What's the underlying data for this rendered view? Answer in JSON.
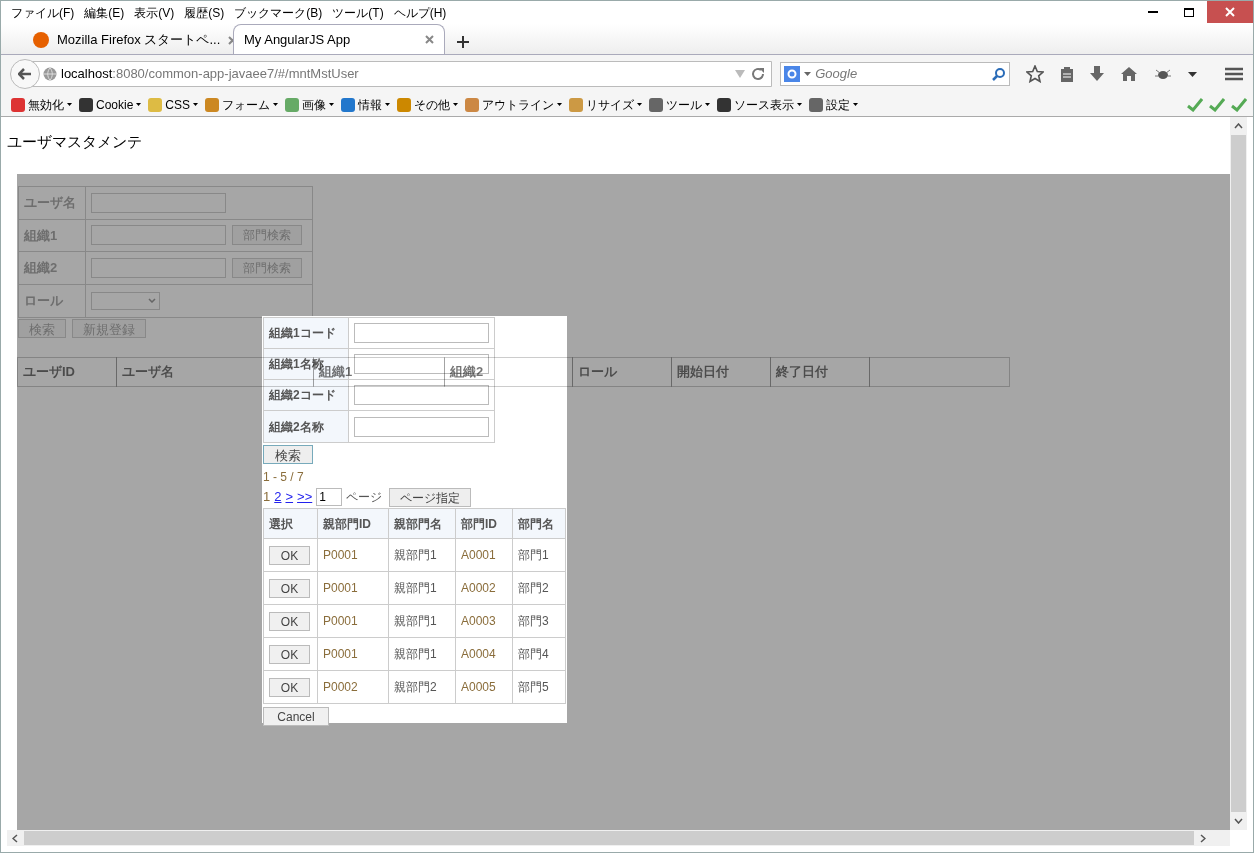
{
  "menu_bar": [
    "ファイル(F)",
    "編集(E)",
    "表示(V)",
    "履歴(S)",
    "ブックマーク(B)",
    "ツール(T)",
    "ヘルプ(H)"
  ],
  "tabs": [
    {
      "label": "Mozilla Firefox スタートペ...",
      "selected": false
    },
    {
      "label": "My AngularJS App",
      "selected": true
    }
  ],
  "address": {
    "host": "localhost",
    "path": ":8080/common-app-javaee7/#/mntMstUser"
  },
  "search": {
    "placeholder": "Google"
  },
  "bookmarks": [
    "無効化",
    "Cookie",
    "CSS",
    "フォーム",
    "画像",
    "情報",
    "その他",
    "アウトライン",
    "リサイズ",
    "ツール",
    "ソース表示",
    "設定"
  ],
  "page_title": "ユーザマスタメンテ",
  "form": {
    "rows": [
      {
        "label": "ユーザ名",
        "kind": "text"
      },
      {
        "label": "組織1",
        "kind": "lookup",
        "button": "部門検索"
      },
      {
        "label": "組織2",
        "kind": "lookup",
        "button": "部門検索"
      },
      {
        "label": "ロール",
        "kind": "select"
      }
    ],
    "buttons": [
      "検索",
      "新規登録"
    ]
  },
  "table": {
    "columns": [
      "ユーザID",
      "ユーザ名",
      "組織1",
      "組織2",
      "ロール",
      "開始日付",
      "終了日付"
    ]
  },
  "dialog": {
    "fields": [
      "組織1コード",
      "組織1名称",
      "組織2コード",
      "組織2名称"
    ],
    "search_button": "検索",
    "range": "1 - 5 / 7",
    "pager": [
      {
        "label": "1",
        "selected": true
      },
      {
        "label": "2",
        "selected": false
      },
      {
        "label": ">",
        "selected": false
      },
      {
        "label": ">>",
        "selected": false
      }
    ],
    "page_input": "1",
    "page_label": "ページ",
    "page_button": "ページ指定",
    "columns": [
      "選択",
      "親部門ID",
      "親部門名",
      "部門ID",
      "部門名"
    ],
    "rows": [
      [
        "OK",
        "P0001",
        "親部門1",
        "A0001",
        "部門1"
      ],
      [
        "OK",
        "P0001",
        "親部門1",
        "A0002",
        "部門2"
      ],
      [
        "OK",
        "P0001",
        "親部門1",
        "A0003",
        "部門3"
      ],
      [
        "OK",
        "P0001",
        "親部門1",
        "A0004",
        "部門4"
      ],
      [
        "OK",
        "P0002",
        "親部門2",
        "A0005",
        "部門5"
      ]
    ],
    "cancel": "Cancel"
  }
}
